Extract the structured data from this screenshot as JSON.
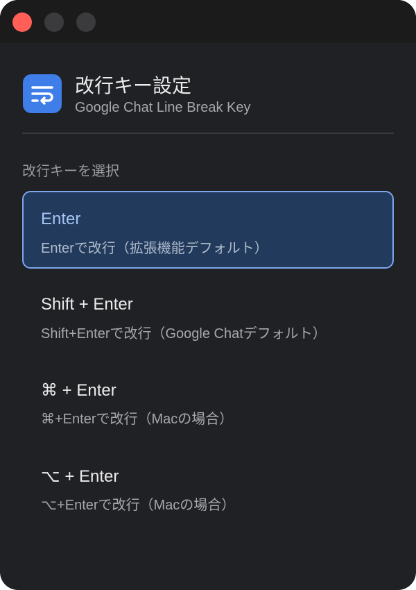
{
  "window": {
    "traffic_lights": [
      "close",
      "minimize",
      "zoom"
    ]
  },
  "header": {
    "icon": "text-wrap-icon",
    "title": "改行キー設定",
    "subtitle": "Google Chat Line Break Key"
  },
  "section": {
    "label": "改行キーを選択"
  },
  "options": [
    {
      "title": "Enter",
      "description": "Enterで改行（拡張機能デフォルト）",
      "selected": true
    },
    {
      "title": "Shift + Enter",
      "description": "Shift+Enterで改行（Google Chatデフォルト）",
      "selected": false
    },
    {
      "title": "⌘ + Enter",
      "description": "⌘+Enterで改行（Macの場合）",
      "selected": false
    },
    {
      "title": "⌥ + Enter",
      "description": "⌥+Enterで改行（Macの場合）",
      "selected": false
    }
  ],
  "colors": {
    "accent": "#3f7de8",
    "selected_bg": "#223a5c",
    "selected_border": "#7fa7ee",
    "window_bg": "#202124"
  }
}
